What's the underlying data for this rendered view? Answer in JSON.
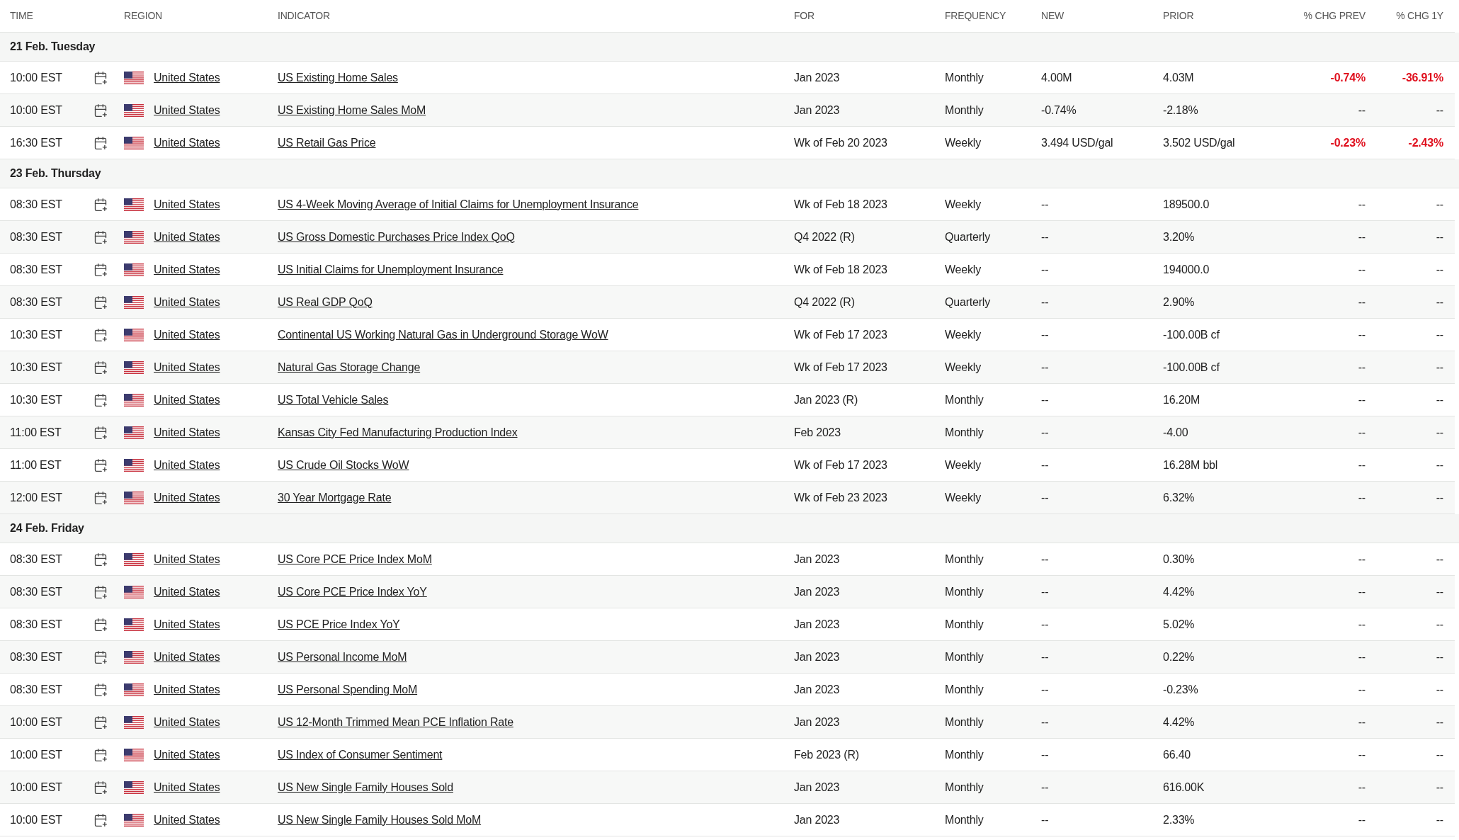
{
  "columns": [
    "TIME",
    "REGION",
    "INDICATOR",
    "FOR",
    "FREQUENCY",
    "NEW",
    "PRIOR",
    "% CHG PREV",
    "% CHG 1Y"
  ],
  "groups": [
    {
      "date": "21 Feb. Tuesday",
      "rows": [
        {
          "time": "10:00 EST",
          "region": "United States",
          "indicator": "US Existing Home Sales",
          "for": "Jan 2023",
          "frequency": "Monthly",
          "new": "4.00M",
          "prior": "4.03M",
          "chg_prev": {
            "text": "-0.74%",
            "negative": true
          },
          "chg_1y": {
            "text": "-36.91%",
            "negative": true
          }
        },
        {
          "time": "10:00 EST",
          "region": "United States",
          "indicator": "US Existing Home Sales MoM",
          "for": "Jan 2023",
          "frequency": "Monthly",
          "new": "-0.74%",
          "prior": "-2.18%",
          "chg_prev": {
            "text": "--",
            "negative": false
          },
          "chg_1y": {
            "text": "--",
            "negative": false
          }
        },
        {
          "time": "16:30 EST",
          "region": "United States",
          "indicator": "US Retail Gas Price",
          "for": "Wk of Feb 20 2023",
          "frequency": "Weekly",
          "new": "3.494 USD/gal",
          "prior": "3.502 USD/gal",
          "chg_prev": {
            "text": "-0.23%",
            "negative": true
          },
          "chg_1y": {
            "text": "-2.43%",
            "negative": true
          }
        }
      ]
    },
    {
      "date": "23 Feb. Thursday",
      "rows": [
        {
          "time": "08:30 EST",
          "region": "United States",
          "indicator": "US 4-Week Moving Average of Initial Claims for Unemployment Insurance",
          "for": "Wk of Feb 18 2023",
          "frequency": "Weekly",
          "new": "--",
          "prior": "189500.0",
          "chg_prev": {
            "text": "--",
            "negative": false
          },
          "chg_1y": {
            "text": "--",
            "negative": false
          }
        },
        {
          "time": "08:30 EST",
          "region": "United States",
          "indicator": "US Gross Domestic Purchases Price Index QoQ",
          "for": "Q4 2022 (R)",
          "frequency": "Quarterly",
          "new": "--",
          "prior": "3.20%",
          "chg_prev": {
            "text": "--",
            "negative": false
          },
          "chg_1y": {
            "text": "--",
            "negative": false
          }
        },
        {
          "time": "08:30 EST",
          "region": "United States",
          "indicator": "US Initial Claims for Unemployment Insurance",
          "for": "Wk of Feb 18 2023",
          "frequency": "Weekly",
          "new": "--",
          "prior": "194000.0",
          "chg_prev": {
            "text": "--",
            "negative": false
          },
          "chg_1y": {
            "text": "--",
            "negative": false
          }
        },
        {
          "time": "08:30 EST",
          "region": "United States",
          "indicator": "US Real GDP QoQ",
          "for": "Q4 2022 (R)",
          "frequency": "Quarterly",
          "new": "--",
          "prior": "2.90%",
          "chg_prev": {
            "text": "--",
            "negative": false
          },
          "chg_1y": {
            "text": "--",
            "negative": false
          }
        },
        {
          "time": "10:30 EST",
          "region": "United States",
          "indicator": "Continental US Working Natural Gas in Underground Storage WoW",
          "for": "Wk of Feb 17 2023",
          "frequency": "Weekly",
          "new": "--",
          "prior": "-100.00B cf",
          "chg_prev": {
            "text": "--",
            "negative": false
          },
          "chg_1y": {
            "text": "--",
            "negative": false
          }
        },
        {
          "time": "10:30 EST",
          "region": "United States",
          "indicator": "Natural Gas Storage Change",
          "for": "Wk of Feb 17 2023",
          "frequency": "Weekly",
          "new": "--",
          "prior": "-100.00B cf",
          "chg_prev": {
            "text": "--",
            "negative": false
          },
          "chg_1y": {
            "text": "--",
            "negative": false
          }
        },
        {
          "time": "10:30 EST",
          "region": "United States",
          "indicator": "US Total Vehicle Sales",
          "for": "Jan 2023 (R)",
          "frequency": "Monthly",
          "new": "--",
          "prior": "16.20M",
          "chg_prev": {
            "text": "--",
            "negative": false
          },
          "chg_1y": {
            "text": "--",
            "negative": false
          }
        },
        {
          "time": "11:00 EST",
          "region": "United States",
          "indicator": "Kansas City Fed Manufacturing Production Index",
          "for": "Feb 2023",
          "frequency": "Monthly",
          "new": "--",
          "prior": "-4.00",
          "chg_prev": {
            "text": "--",
            "negative": false
          },
          "chg_1y": {
            "text": "--",
            "negative": false
          }
        },
        {
          "time": "11:00 EST",
          "region": "United States",
          "indicator": "US Crude Oil Stocks WoW",
          "for": "Wk of Feb 17 2023",
          "frequency": "Weekly",
          "new": "--",
          "prior": "16.28M bbl",
          "chg_prev": {
            "text": "--",
            "negative": false
          },
          "chg_1y": {
            "text": "--",
            "negative": false
          }
        },
        {
          "time": "12:00 EST",
          "region": "United States",
          "indicator": "30 Year Mortgage Rate",
          "for": "Wk of Feb 23 2023",
          "frequency": "Weekly",
          "new": "--",
          "prior": "6.32%",
          "chg_prev": {
            "text": "--",
            "negative": false
          },
          "chg_1y": {
            "text": "--",
            "negative": false
          }
        }
      ]
    },
    {
      "date": "24 Feb. Friday",
      "rows": [
        {
          "time": "08:30 EST",
          "region": "United States",
          "indicator": "US Core PCE Price Index MoM",
          "for": "Jan 2023",
          "frequency": "Monthly",
          "new": "--",
          "prior": "0.30%",
          "chg_prev": {
            "text": "--",
            "negative": false
          },
          "chg_1y": {
            "text": "--",
            "negative": false
          }
        },
        {
          "time": "08:30 EST",
          "region": "United States",
          "indicator": "US Core PCE Price Index YoY",
          "for": "Jan 2023",
          "frequency": "Monthly",
          "new": "--",
          "prior": "4.42%",
          "chg_prev": {
            "text": "--",
            "negative": false
          },
          "chg_1y": {
            "text": "--",
            "negative": false
          }
        },
        {
          "time": "08:30 EST",
          "region": "United States",
          "indicator": "US PCE Price Index YoY",
          "for": "Jan 2023",
          "frequency": "Monthly",
          "new": "--",
          "prior": "5.02%",
          "chg_prev": {
            "text": "--",
            "negative": false
          },
          "chg_1y": {
            "text": "--",
            "negative": false
          }
        },
        {
          "time": "08:30 EST",
          "region": "United States",
          "indicator": "US Personal Income MoM",
          "for": "Jan 2023",
          "frequency": "Monthly",
          "new": "--",
          "prior": "0.22%",
          "chg_prev": {
            "text": "--",
            "negative": false
          },
          "chg_1y": {
            "text": "--",
            "negative": false
          }
        },
        {
          "time": "08:30 EST",
          "region": "United States",
          "indicator": "US Personal Spending MoM",
          "for": "Jan 2023",
          "frequency": "Monthly",
          "new": "--",
          "prior": "-0.23%",
          "chg_prev": {
            "text": "--",
            "negative": false
          },
          "chg_1y": {
            "text": "--",
            "negative": false
          }
        },
        {
          "time": "10:00 EST",
          "region": "United States",
          "indicator": "US 12-Month Trimmed Mean PCE Inflation Rate",
          "for": "Jan 2023",
          "frequency": "Monthly",
          "new": "--",
          "prior": "4.42%",
          "chg_prev": {
            "text": "--",
            "negative": false
          },
          "chg_1y": {
            "text": "--",
            "negative": false
          }
        },
        {
          "time": "10:00 EST",
          "region": "United States",
          "indicator": "US Index of Consumer Sentiment",
          "for": "Feb 2023 (R)",
          "frequency": "Monthly",
          "new": "--",
          "prior": "66.40",
          "chg_prev": {
            "text": "--",
            "negative": false
          },
          "chg_1y": {
            "text": "--",
            "negative": false
          }
        },
        {
          "time": "10:00 EST",
          "region": "United States",
          "indicator": "US New Single Family Houses Sold",
          "for": "Jan 2023",
          "frequency": "Monthly",
          "new": "--",
          "prior": "616.00K",
          "chg_prev": {
            "text": "--",
            "negative": false
          },
          "chg_1y": {
            "text": "--",
            "negative": false
          }
        },
        {
          "time": "10:00 EST",
          "region": "United States",
          "indicator": "US New Single Family Houses Sold MoM",
          "for": "Jan 2023",
          "frequency": "Monthly",
          "new": "--",
          "prior": "2.33%",
          "chg_prev": {
            "text": "--",
            "negative": false
          },
          "chg_1y": {
            "text": "--",
            "negative": false
          }
        }
      ]
    }
  ]
}
